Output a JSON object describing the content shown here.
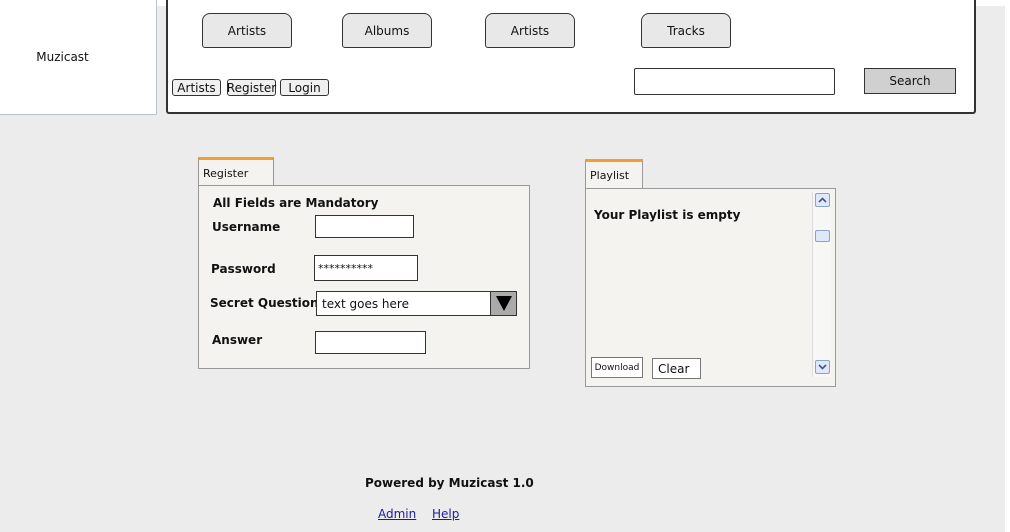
{
  "brand": {
    "name": "Muzicast"
  },
  "nav": {
    "tabs": [
      "Artists",
      "Albums",
      "Artists",
      "Tracks"
    ],
    "small_buttons": [
      "Artists",
      "Register",
      "Login"
    ],
    "search": {
      "value": "",
      "button_label": "Search"
    }
  },
  "register": {
    "tab_label": "Register",
    "notice": "All Fields are Mandatory",
    "username_label": "Username",
    "username_value": "",
    "password_label": "Password",
    "password_value": "**********",
    "secret_question_label": "Secret Question",
    "secret_question_value": "text goes here",
    "answer_label": "Answer",
    "answer_value": ""
  },
  "playlist": {
    "tab_label": "Playlist",
    "empty_text": "Your Playlist is empty",
    "download_label": "Download",
    "clear_label": "Clear"
  },
  "footer": {
    "powered_by": "Powered by Muzicast 1.0",
    "links": [
      "Admin",
      "Help"
    ]
  },
  "colors": {
    "tab_accent": "#f0a030",
    "link": "#1a1aa6"
  }
}
